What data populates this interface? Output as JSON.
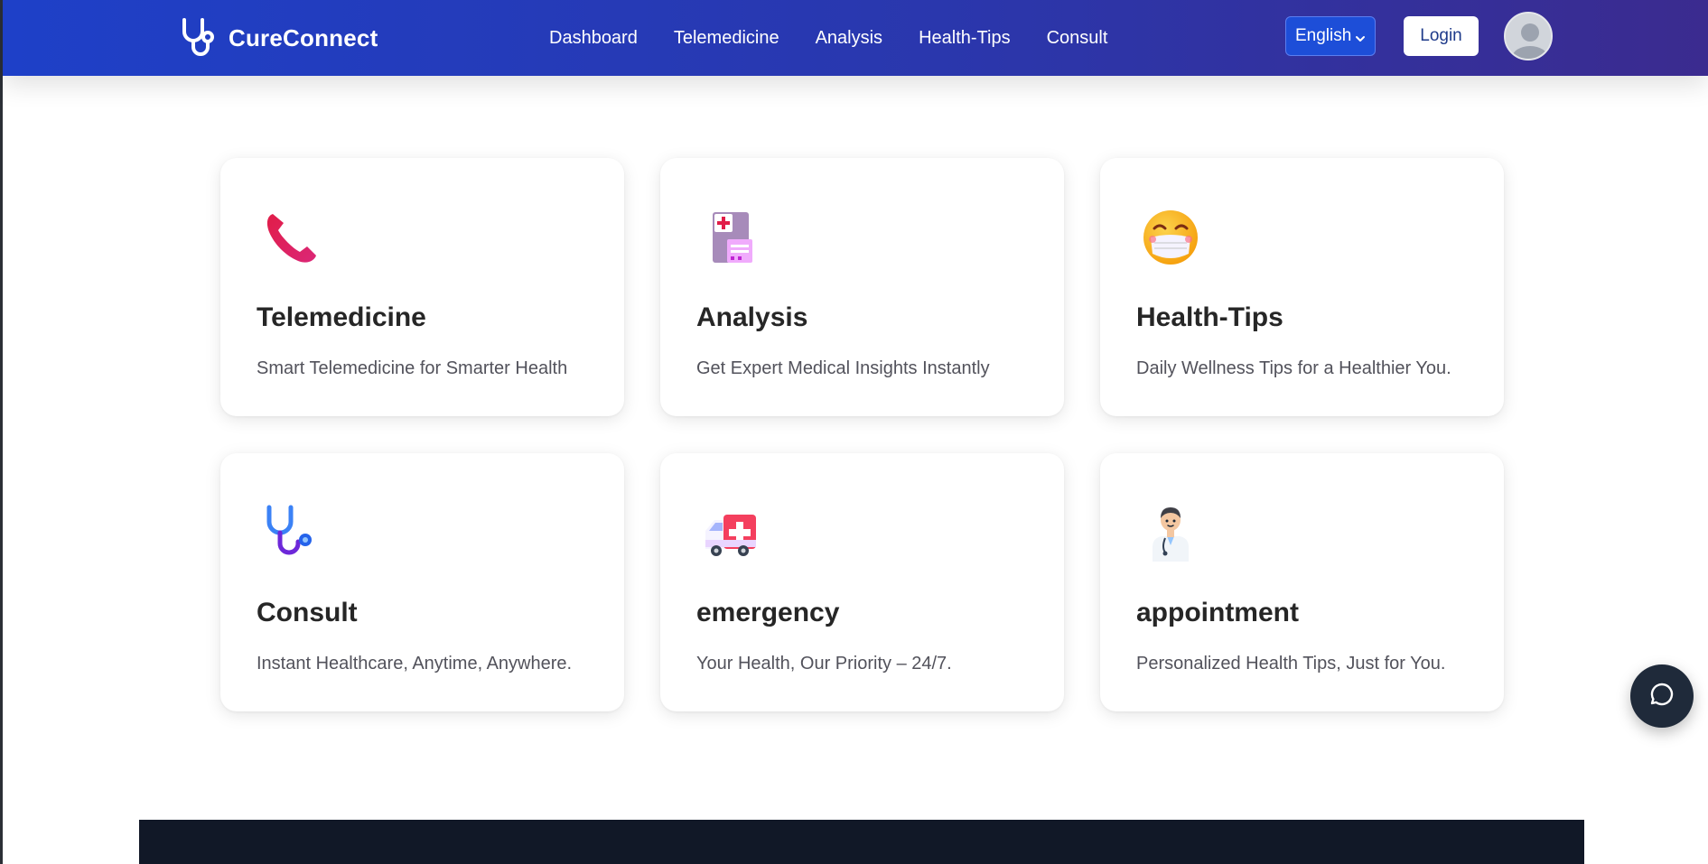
{
  "header": {
    "brand": "CureConnect",
    "nav": [
      "Dashboard",
      "Telemedicine",
      "Analysis",
      "Health-Tips",
      "Consult"
    ],
    "language": "English",
    "login_label": "Login"
  },
  "cards": [
    {
      "title": "Telemedicine",
      "desc": "Smart Telemedicine for Smarter Health",
      "icon": "telephone-icon"
    },
    {
      "title": "Analysis",
      "desc": "Get Expert Medical Insights Instantly",
      "icon": "hospital-document-icon"
    },
    {
      "title": "Health-Tips",
      "desc": "Daily Wellness Tips for a Healthier You.",
      "icon": "face-mask-emoji-icon"
    },
    {
      "title": "Consult",
      "desc": "Instant Healthcare, Anytime, Anywhere.",
      "icon": "stethoscope-icon"
    },
    {
      "title": "emergency",
      "desc": "Your Health, Our Priority – 24/7.",
      "icon": "ambulance-icon"
    },
    {
      "title": "appointment",
      "desc": "Personalized Health Tips, Just for You.",
      "icon": "doctor-icon"
    }
  ],
  "colors": {
    "header_start": "#1e40c8",
    "header_end": "#3b2b8f",
    "chat_button": "#1f2a3a",
    "footer": "#111827"
  }
}
